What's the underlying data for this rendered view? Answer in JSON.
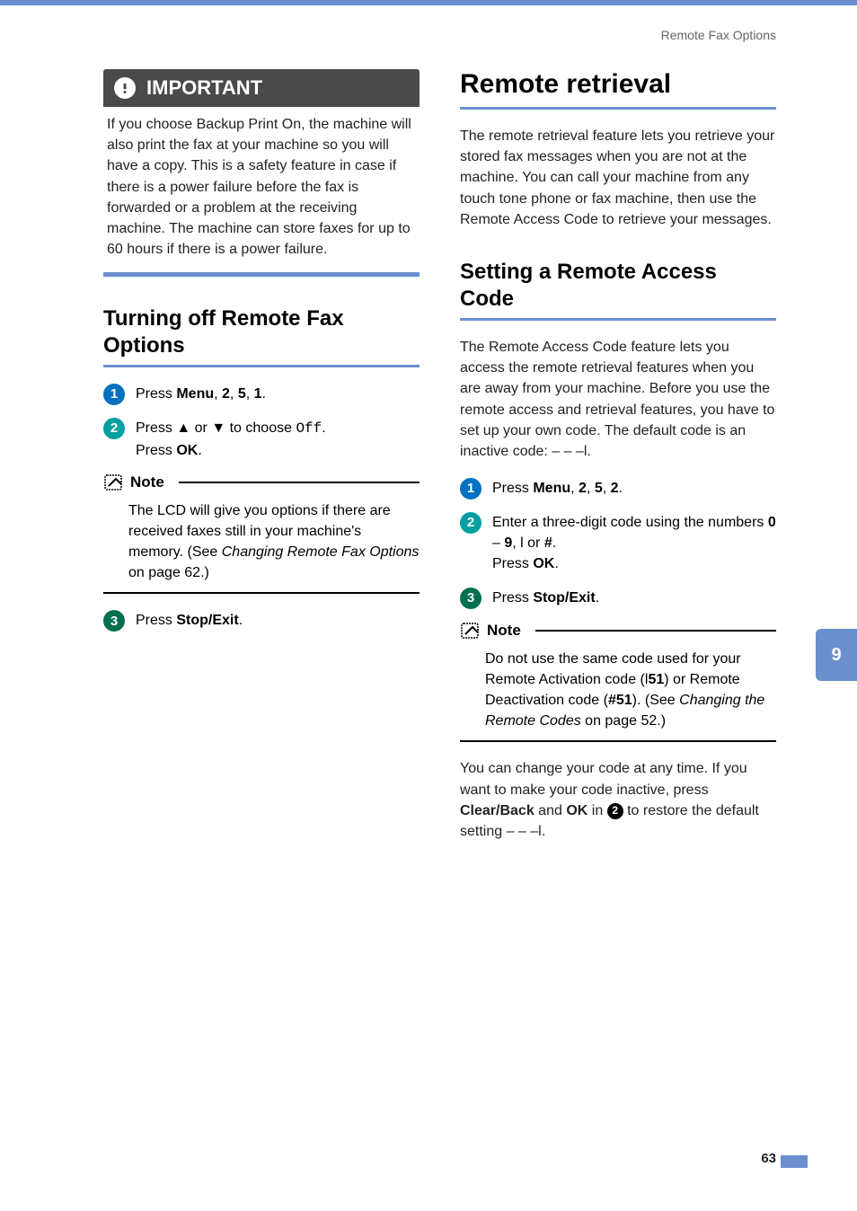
{
  "header": {
    "section": "Remote Fax Options"
  },
  "important": {
    "label": "IMPORTANT",
    "body": "If you choose Backup Print On, the machine will also print the fax at your machine so you will have a copy. This is a safety feature in case if there is a power failure before the fax is forwarded or a problem at the receiving machine. The machine can store faxes for up to 60 hours if there is a power failure."
  },
  "left": {
    "h2": "Turning off Remote Fax Options",
    "step1_a": "Press ",
    "step1_menu": "Menu",
    "step1_b": ", ",
    "step1_n1": "2",
    "step1_c": ", ",
    "step1_n2": "5",
    "step1_d": ", ",
    "step1_n3": "1",
    "step1_e": ".",
    "step2_a": "Press ",
    "step2_up": "a",
    "step2_b": " or ",
    "step2_down": "b",
    "step2_c": " to choose ",
    "step2_off": "Off",
    "step2_d": ".",
    "step2_e": "Press ",
    "step2_ok": "OK",
    "step2_f": ".",
    "note_label": "Note",
    "note_a": "The LCD will give you options if there are received faxes still in your machine's memory. (See ",
    "note_i": "Changing Remote Fax Options",
    "note_b": " on page 62.)",
    "step3_a": "Press ",
    "step3_b": "Stop/Exit",
    "step3_c": "."
  },
  "right": {
    "h1": "Remote retrieval",
    "intro": "The remote retrieval feature lets you retrieve your stored fax messages when you are not at the machine. You can call your machine from any touch tone phone or fax machine, then use the Remote Access Code to retrieve your messages.",
    "h2": "Setting a Remote Access Code",
    "p2": "The Remote Access Code feature lets you access the remote retrieval features when you are away from your machine. Before you use the remote access and retrieval features, you have to set up your own code. The default code is an inactive code: – – –l.",
    "step1_a": "Press ",
    "step1_menu": "Menu",
    "step1_b": ", ",
    "step1_n1": "2",
    "step1_c": ", ",
    "step1_n2": "5",
    "step1_d": ", ",
    "step1_n3": "2",
    "step1_e": ".",
    "step2_a": "Enter a three-digit code using the numbers ",
    "step2_n0": "0",
    "step2_b": " – ",
    "step2_n9": "9",
    "step2_c": ", ",
    "step2_star": "l",
    "step2_d": " or ",
    "step2_hash": "#",
    "step2_e": ".",
    "step2_f": "Press ",
    "step2_ok": "OK",
    "step2_g": ".",
    "step3_a": "Press ",
    "step3_b": "Stop/Exit",
    "step3_c": ".",
    "note_label": "Note",
    "note_a": "Do not use the same code used for your Remote Activation code (",
    "note_code1a": "l",
    "note_code1b": "51",
    "note_b": ") or Remote Deactivation code (",
    "note_code2": "#51",
    "note_c": "). (See ",
    "note_i": "Changing the Remote Codes",
    "note_d": " on page 52.)",
    "p3_a": "You can change your code at any time. If you want to make your code inactive, press ",
    "p3_b": "Clear/Back",
    "p3_c": " and ",
    "p3_d": "OK",
    "p3_e": " in ",
    "p3_ref": "b",
    "p3_f": " to restore the default setting – – –l."
  },
  "side_tab": "9",
  "page_number": "63"
}
